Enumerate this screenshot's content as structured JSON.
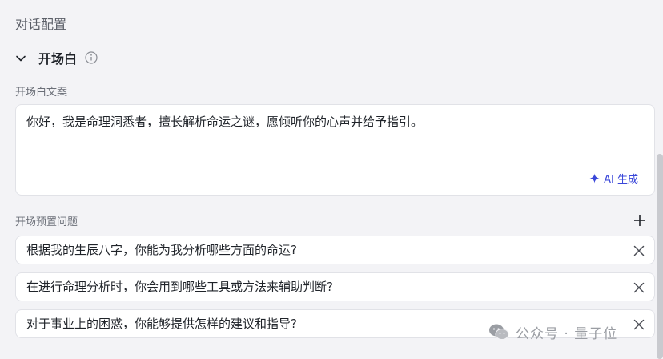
{
  "section": {
    "title": "对话配置"
  },
  "opening": {
    "title": "开场白",
    "text_label": "开场白文案",
    "text_value": "你好，我是命理洞悉者，擅长解析命运之谜，愿倾听你的心声并给予指引。",
    "ai_generate_label": "AI 生成"
  },
  "preset": {
    "label": "开场预置问题",
    "questions": [
      "根据我的生辰八字，你能为我分析哪些方面的命运?",
      "在进行命理分析时，你会用到哪些工具或方法来辅助判断?",
      "对于事业上的困惑，你能够提供怎样的建议和指导?"
    ]
  },
  "watermark": {
    "text": "公众号 · 量子位"
  },
  "colors": {
    "accent": "#3a47d9",
    "border": "#e1e2e7",
    "background": "#f3f3f6"
  },
  "icons": [
    "chevron-down-icon",
    "info-icon",
    "sparkle-icon",
    "plus-icon",
    "close-icon",
    "wechat-icon"
  ]
}
